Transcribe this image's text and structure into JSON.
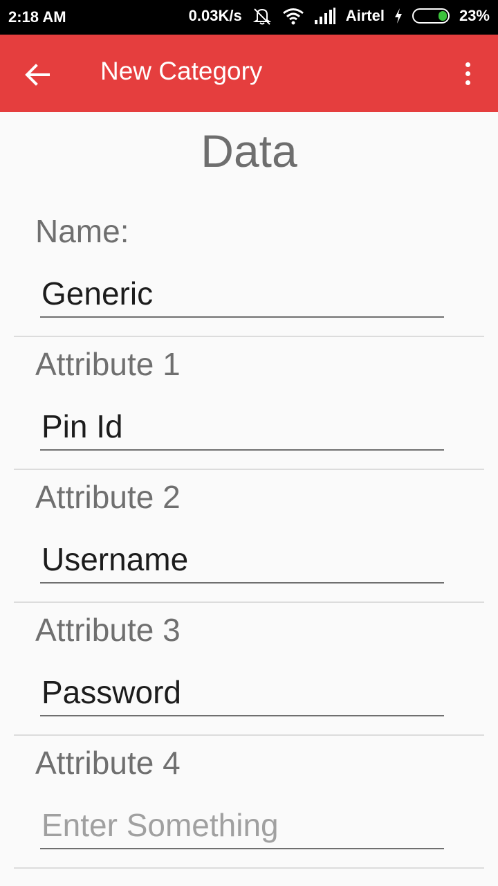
{
  "status_bar": {
    "time": "2:18 AM",
    "net_speed": "0.03K/s",
    "carrier": "Airtel",
    "battery": "23%",
    "battery_color": "#3cc23c"
  },
  "app_bar": {
    "title": "New Category",
    "color": "#e53e3e",
    "back_icon": "arrow-back-icon",
    "menu_icon": "more-vert-icon"
  },
  "heading": "Data",
  "fields": [
    {
      "label": "Name:",
      "value": "Generic",
      "placeholder": ""
    },
    {
      "label": "Attribute 1",
      "value": "Pin Id",
      "placeholder": ""
    },
    {
      "label": "Attribute 2",
      "value": "Username",
      "placeholder": ""
    },
    {
      "label": "Attribute 3",
      "value": "Password",
      "placeholder": ""
    },
    {
      "label": "Attribute 4",
      "value": "",
      "placeholder": "Enter Something"
    }
  ]
}
